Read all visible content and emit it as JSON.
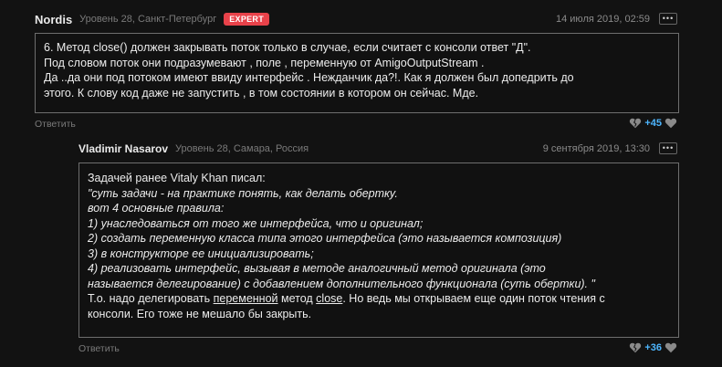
{
  "comments": [
    {
      "author": "Nordis",
      "meta": "Уровень 28, Санкт-Петербург",
      "badge": "EXPERT",
      "date": "14 июля 2019, 02:59",
      "more": "•••",
      "lines": [
        "6. Метод close() должен закрывать поток только в случае, если считает с консоли ответ \"Д\".",
        "Под словом поток они подразумевают , поле , переменную  от AmigoOutputStream .",
        "Да ..да они под потоком имеют ввиду интерфейс . Нежданчик  да?!. Как я должен был допедрить до",
        "этого. К слову код даже не запустить , в том состоянии в котором он сейчас. Мде."
      ],
      "reply": "Ответить",
      "score": "+45"
    },
    {
      "author": "Vladimir Nasarov",
      "meta": "Уровень 28, Самара, Россия",
      "date": "9 сентября 2019, 13:30",
      "more": "•••",
      "intro": "Задачей ранее Vitaly Khan писал:",
      "quote_lines": [
        "\"суть задачи - на практике понять, как делать обертку.",
        "вот 4 основные правила:",
        "1) унаследоваться от того же интерфейса, что и оригинал;",
        "2) создать переменную класса типа этого интерфейса (это называется композиция)",
        "3) в конструкторе ее инициализировать;",
        "4) реализовать интерфейс, вызывая в методе аналогичный метод оригинала (это",
        "называется делегирование) с добавлением дополнительного функционала (суть обертки). \""
      ],
      "tail": {
        "before": "Т.о. надо делегировать ",
        "link1": "переменной",
        "middle": " метод ",
        "link2": "close",
        "after": ". Но ведь мы открываем еще один поток чтения с",
        "last": "консоли. Его тоже не мешало бы закрыть."
      },
      "reply": "Ответить",
      "score": "+36"
    }
  ]
}
